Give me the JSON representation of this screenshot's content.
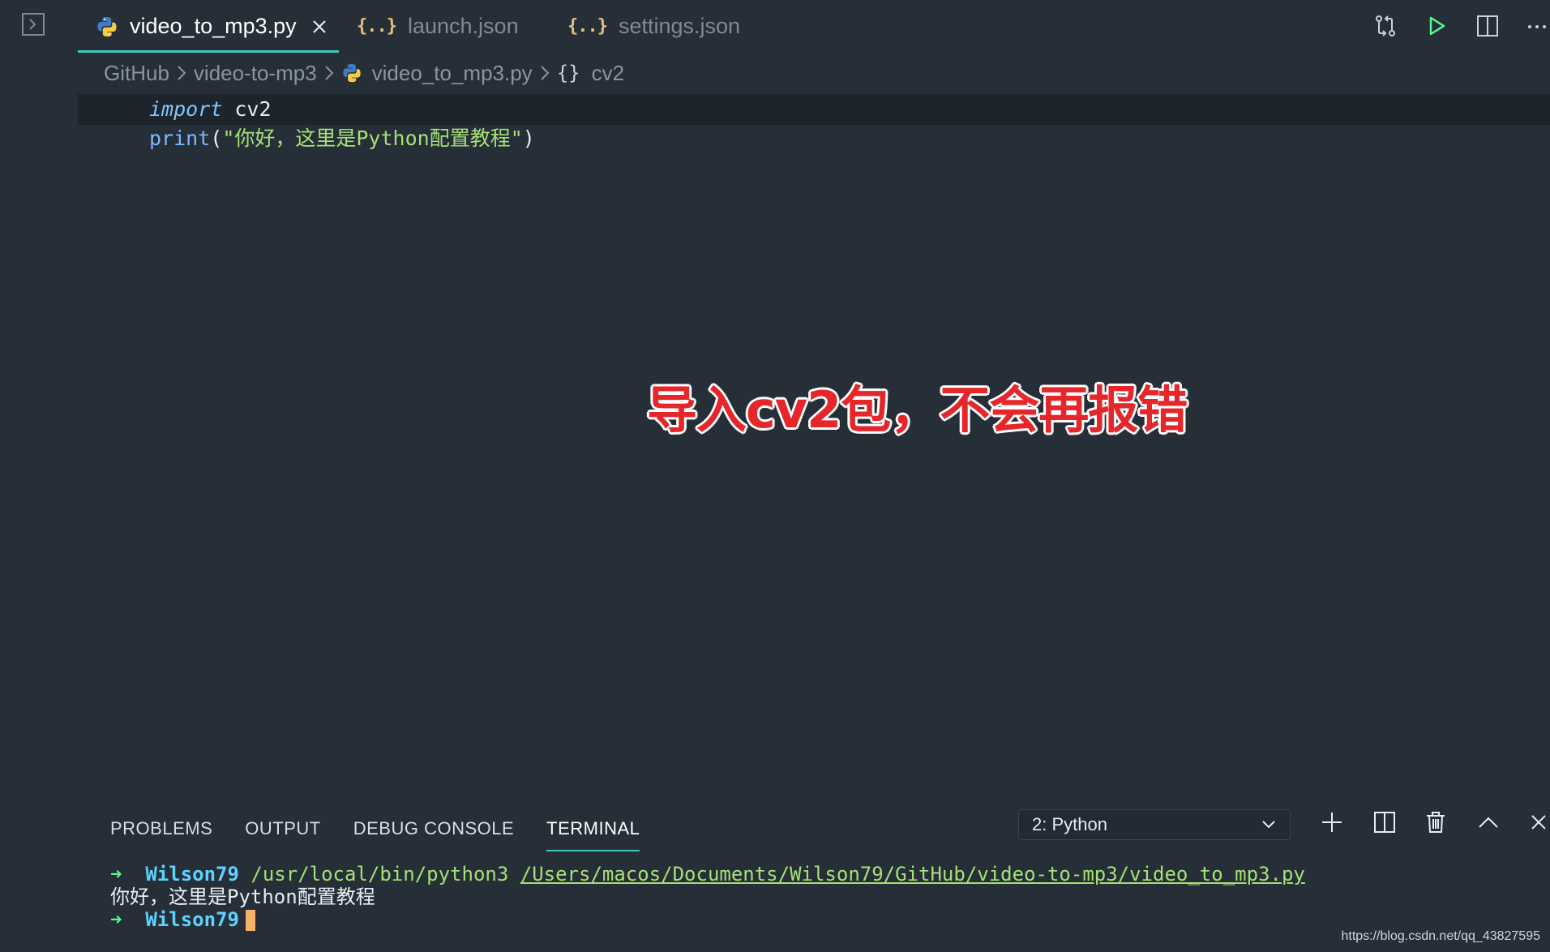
{
  "tabs": [
    {
      "label": "video_to_mp3.py",
      "icon": "python-icon",
      "active": true
    },
    {
      "label": "launch.json",
      "icon": "json-icon",
      "active": false
    },
    {
      "label": "settings.json",
      "icon": "json-icon",
      "active": false
    }
  ],
  "tab_json_glyph": "{..}",
  "breadcrumb": {
    "items": [
      "GitHub",
      "video-to-mp3",
      "video_to_mp3.py",
      "cv2"
    ],
    "braces": "{}"
  },
  "code": {
    "line1": {
      "keyword": "import",
      "rest": " cv2"
    },
    "line2": {
      "func": "print",
      "open": "(",
      "string": "\"你好，这里是Python配置教程\"",
      "close": ")"
    }
  },
  "annotation": "导入cv2包，不会再报错",
  "panel": {
    "tabs": [
      "PROBLEMS",
      "OUTPUT",
      "DEBUG CONSOLE",
      "TERMINAL"
    ],
    "active_tab": "TERMINAL",
    "terminal_select": "2: Python"
  },
  "terminal": {
    "prompt_arrow": "➜",
    "user": "Wilson79",
    "exe": "/usr/local/bin/python3",
    "script_path": "/Users/macos/Documents/Wilson79/GitHub/video-to-mp3/video_to_mp3.py",
    "output": "你好，这里是Python配置教程"
  },
  "watermark": "https://blog.csdn.net/qq_43827595",
  "colors": {
    "accent": "#41c7b9",
    "background": "#262e38",
    "annotation": "#e5262b"
  }
}
